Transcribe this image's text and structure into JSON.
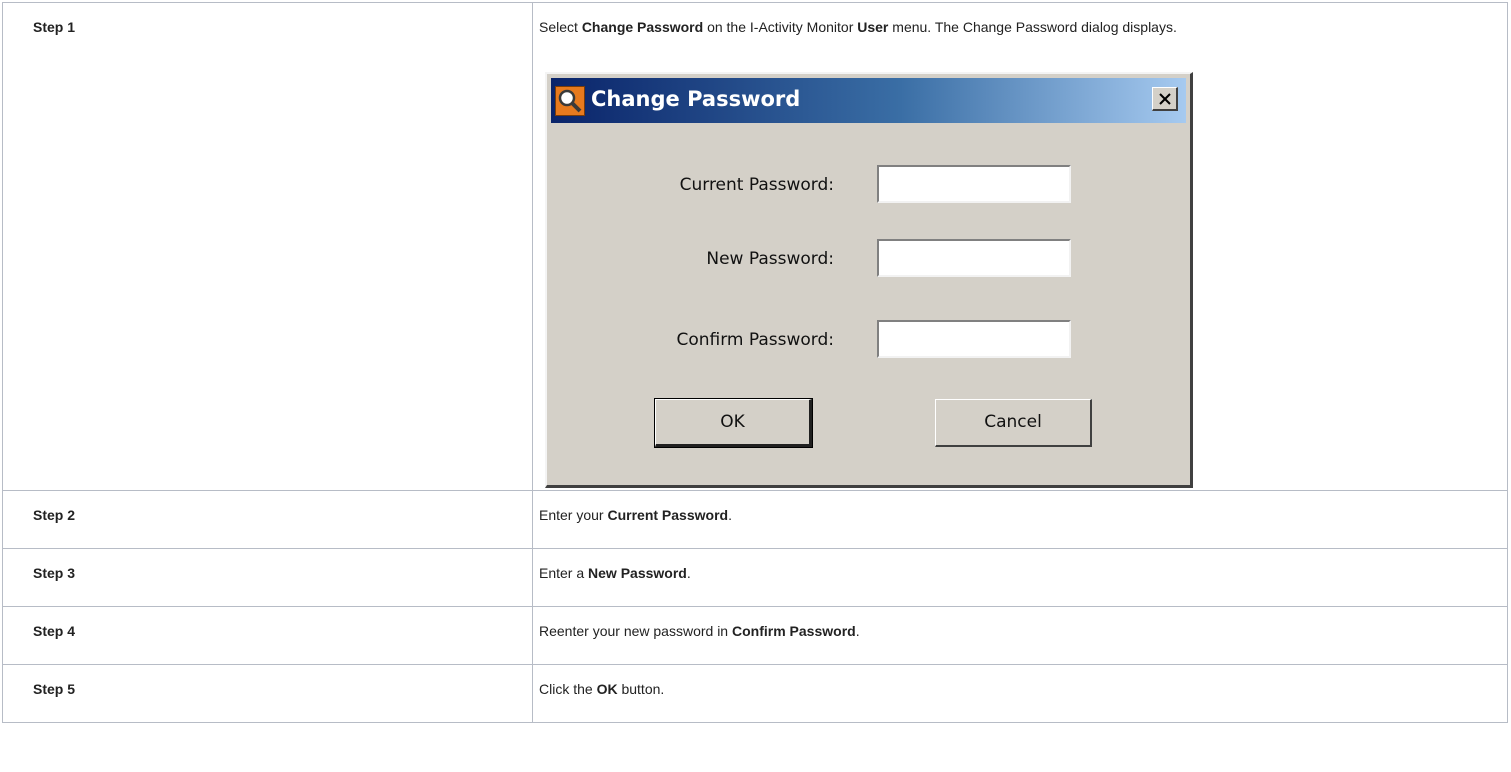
{
  "steps": [
    {
      "label": "Step 1",
      "desc": [
        {
          "t": "Select "
        },
        {
          "t": "Change Password",
          "b": true
        },
        {
          "t": " on the I-Activity Monitor "
        },
        {
          "t": "User",
          "b": true
        },
        {
          "t": " menu. The Change Password dialog displays."
        }
      ]
    },
    {
      "label": "Step 2",
      "desc": [
        {
          "t": "Enter your "
        },
        {
          "t": "Current Password",
          "b": true
        },
        {
          "t": "."
        }
      ]
    },
    {
      "label": "Step 3",
      "desc": [
        {
          "t": "Enter a "
        },
        {
          "t": "New Password",
          "b": true
        },
        {
          "t": "."
        }
      ]
    },
    {
      "label": "Step 4",
      "desc": [
        {
          "t": "Reenter your new password in "
        },
        {
          "t": "Confirm Password",
          "b": true
        },
        {
          "t": "."
        }
      ]
    },
    {
      "label": "Step 5",
      "desc": [
        {
          "t": "Click the "
        },
        {
          "t": "OK",
          "b": true
        },
        {
          "t": " button."
        }
      ]
    }
  ],
  "dialog": {
    "title": "Change Password",
    "icon": "magnifier-app-icon",
    "close_icon": "close-icon",
    "fields": {
      "current_label": "Current Password:",
      "current_value": "",
      "new_label": "New Password:",
      "new_value": "",
      "confirm_label": "Confirm Password:",
      "confirm_value": ""
    },
    "ok_label": "OK",
    "cancel_label": "Cancel"
  }
}
